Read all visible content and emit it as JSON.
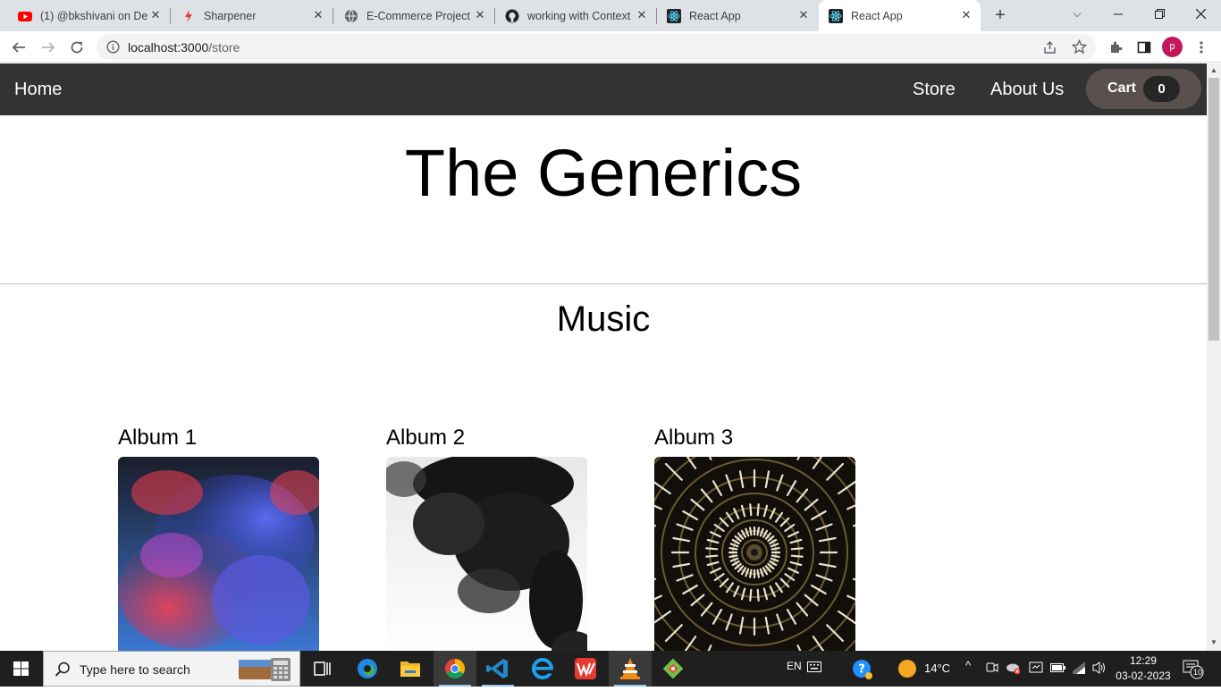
{
  "browser": {
    "tabs": [
      {
        "title": "(1) @bkshivani on De",
        "icon": "youtube-icon",
        "active": false
      },
      {
        "title": "Sharpener",
        "icon": "sharpener-icon",
        "active": false
      },
      {
        "title": "E-Commerce Project",
        "icon": "globe-icon",
        "active": false
      },
      {
        "title": "working with Context",
        "icon": "github-icon",
        "active": false
      },
      {
        "title": "React App",
        "icon": "react-icon",
        "active": false
      },
      {
        "title": "React App",
        "icon": "react-icon",
        "active": true
      }
    ],
    "url_host": "localhost:3000",
    "url_path": "/store",
    "profile_initial": "p"
  },
  "navbar": {
    "home": "Home",
    "store": "Store",
    "about": "About Us",
    "cart_label": "Cart",
    "cart_count": "0"
  },
  "hero": {
    "title": "The Generics"
  },
  "section": {
    "title": "Music"
  },
  "albums": [
    {
      "title": "Album 1",
      "art": "colorful-smoke-cover"
    },
    {
      "title": "Album 2",
      "art": "black-ink-cover"
    },
    {
      "title": "Album 3",
      "art": "radial-tunnel-cover"
    }
  ],
  "taskbar": {
    "search_placeholder": "Type here to search",
    "language": "EN",
    "temperature": "14°C",
    "time": "12:29",
    "date": "03-02-2023",
    "notification_count": "10"
  },
  "colors": {
    "navbar_bg": "#333333",
    "cart_button_bg": "#5a514f",
    "cart_count_bg": "#262626"
  }
}
